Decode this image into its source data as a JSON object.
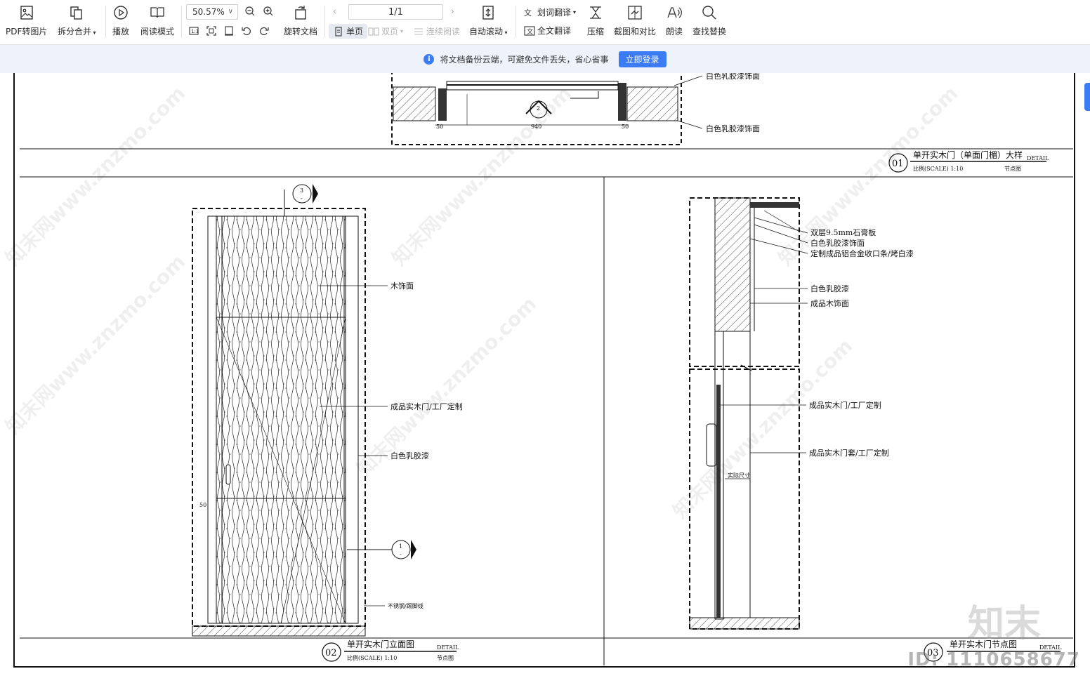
{
  "toolbar": {
    "pdf_to_image": "PDF转图片",
    "split_merge": "拆分合并",
    "play": "播放",
    "read_mode": "阅读模式",
    "zoom": "50.57%",
    "rotate_doc": "旋转文档",
    "page": "1/1",
    "single_page": "单页",
    "double_page": "双页",
    "continuous": "连续阅读",
    "auto_scroll": "自动滚动",
    "word_translate": "划词翻译",
    "full_translate": "全文翻译",
    "compress": "压缩",
    "screenshot_compare": "截图和对比",
    "read_aloud": "朗读",
    "find_replace": "查找替换"
  },
  "notice": {
    "message": "将文档备份云端，可避免文件丢失，省心省事",
    "login_button": "立即登录"
  },
  "drawing": {
    "top_labels": [
      "白色乳胶漆饰面",
      "白色乳胶漆饰面"
    ],
    "detail01": {
      "num": "01",
      "title": "单开实木门（单面门楣）大样",
      "detail": "DETAIL",
      "scale": "比例(SCALE) 1:10",
      "type": "节点图"
    },
    "detail02": {
      "num": "02",
      "title": "单开实木门立面图",
      "detail": "DETAIL",
      "scale": "比例(SCALE) 1:10",
      "type": "节点图"
    },
    "detail03": {
      "num": "03",
      "title": "单开实木门节点图",
      "detail": "DETAIL"
    },
    "elev_labels": [
      "木饰面",
      "成品实木门/工厂定制",
      "白色乳胶漆",
      "不锈钢/踢脚线"
    ],
    "section_labels": [
      "双层9.5mm石膏板",
      "白色乳胶漆饰面",
      "定制成品铝合金收口条/烤白漆",
      "白色乳胶漆",
      "成品木饰面",
      "成品实木门/工厂定制",
      "成品实木门套/工厂定制",
      "实际尺寸"
    ],
    "markers": {
      "m1": "1",
      "m2": "2",
      "m3": "3",
      "dash": "-"
    },
    "dims": {
      "d50": "50",
      "d940": "940"
    },
    "watermark": "知末网www.znzmo.com",
    "logo": "知末",
    "id_text": "ID: 1110658677"
  }
}
